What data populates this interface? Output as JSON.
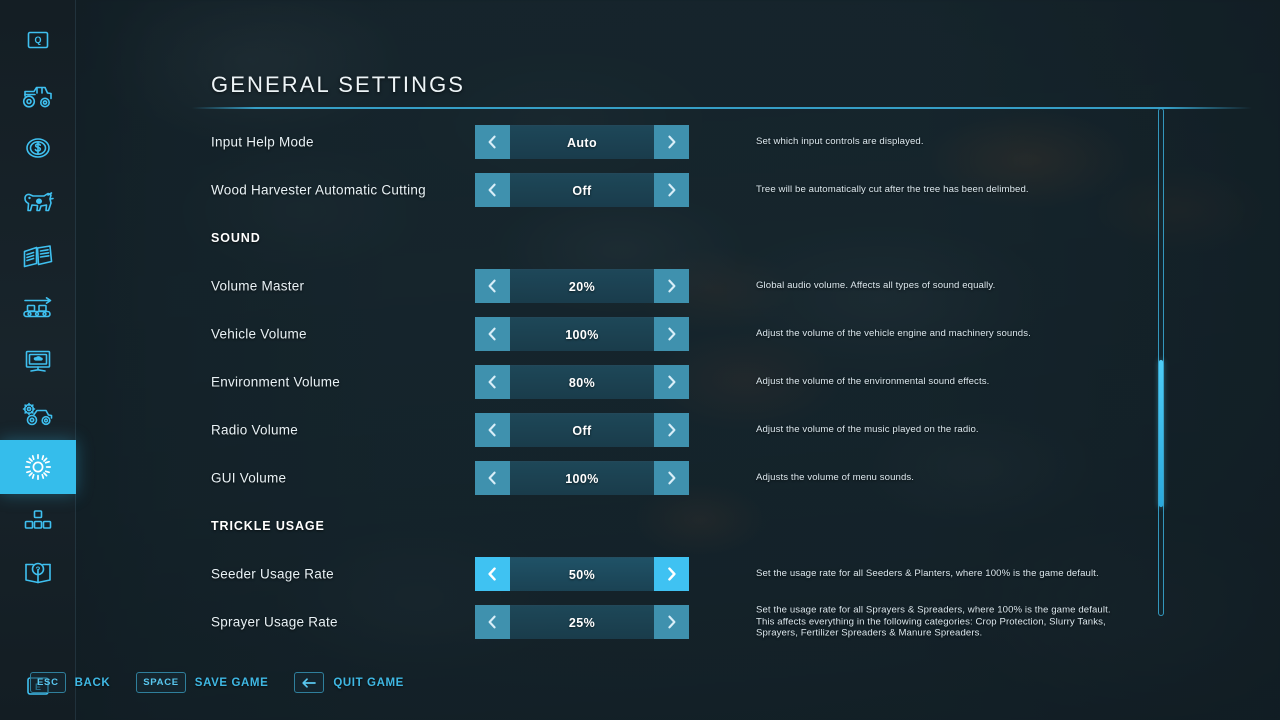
{
  "page": {
    "title": "GENERAL SETTINGS"
  },
  "sidebar": {
    "items": [
      {
        "icon": "quest-screen-icon",
        "label": "Quests",
        "active": false
      },
      {
        "icon": "tractor-icon",
        "label": "Vehicles",
        "active": false
      },
      {
        "icon": "dollar-coin-icon",
        "label": "Finances",
        "active": false
      },
      {
        "icon": "cow-icon",
        "label": "Animals",
        "active": false
      },
      {
        "icon": "documents-icon",
        "label": "Contracts",
        "active": false
      },
      {
        "icon": "production-chain-icon",
        "label": "Production",
        "active": false
      },
      {
        "icon": "map-overview-icon",
        "label": "Map",
        "active": false
      },
      {
        "icon": "vehicle-settings-icon",
        "label": "Game Settings",
        "active": false
      },
      {
        "icon": "gear-icon",
        "label": "General Settings",
        "active": true
      },
      {
        "icon": "mods-blocks-icon",
        "label": "Mods",
        "active": false
      },
      {
        "icon": "help-book-icon",
        "label": "Help",
        "active": false
      }
    ],
    "bottom_key": {
      "icon": "key-e-icon",
      "label": "E"
    }
  },
  "settings": [
    {
      "type": "option",
      "label": "Input Help Mode",
      "value": "Auto",
      "description": "Set which input controls are displayed.",
      "selected": false
    },
    {
      "type": "option",
      "label": "Wood Harvester Automatic Cutting",
      "value": "Off",
      "description": "Tree will be automatically cut after the tree has been delimbed.",
      "selected": false
    },
    {
      "type": "section",
      "label": "SOUND"
    },
    {
      "type": "option",
      "label": "Volume Master",
      "value": "20%",
      "description": "Global audio volume. Affects all types of sound equally.",
      "selected": false
    },
    {
      "type": "option",
      "label": "Vehicle Volume",
      "value": "100%",
      "description": "Adjust the volume of the vehicle engine and machinery sounds.",
      "selected": false
    },
    {
      "type": "option",
      "label": "Environment Volume",
      "value": "80%",
      "description": "Adjust the volume of the environmental sound effects.",
      "selected": false
    },
    {
      "type": "option",
      "label": "Radio Volume",
      "value": "Off",
      "description": "Adjust the volume of the music played on the radio.",
      "selected": false
    },
    {
      "type": "option",
      "label": "GUI Volume",
      "value": "100%",
      "description": "Adjusts the volume of menu sounds.",
      "selected": false
    },
    {
      "type": "section",
      "label": "TRICKLE USAGE"
    },
    {
      "type": "option",
      "label": "Seeder Usage Rate",
      "value": "50%",
      "description": "Set the usage rate for all Seeders & Planters, where 100% is the game default.",
      "selected": true
    },
    {
      "type": "option",
      "label": "Sprayer Usage Rate",
      "value": "25%",
      "description": "Set the usage rate for all Sprayers & Spreaders, where 100% is the game default. This affects everything in the following categories: Crop Protection, Slurry Tanks, Sprayers, Fertilizer Spreaders & Manure Spreaders.",
      "selected": false
    }
  ],
  "hotkeys": [
    {
      "key": "ESC",
      "key_icon": "esc-key-icon",
      "label": "BACK"
    },
    {
      "key": "SPACE",
      "key_icon": "space-key-icon",
      "label": "SAVE GAME"
    },
    {
      "key": "",
      "key_icon": "backspace-key-icon",
      "label": "QUIT GAME"
    }
  ],
  "scrollbar": {
    "thumb_top_pct": 70,
    "thumb_height_pct": 29
  },
  "colors": {
    "accent": "#3fc2f2",
    "accent_dim": "#3f91ae",
    "background": "#1b2b33",
    "rail": "#141e24",
    "text": "#e9f2f6",
    "hotkey_text": "#3fb8e4"
  }
}
